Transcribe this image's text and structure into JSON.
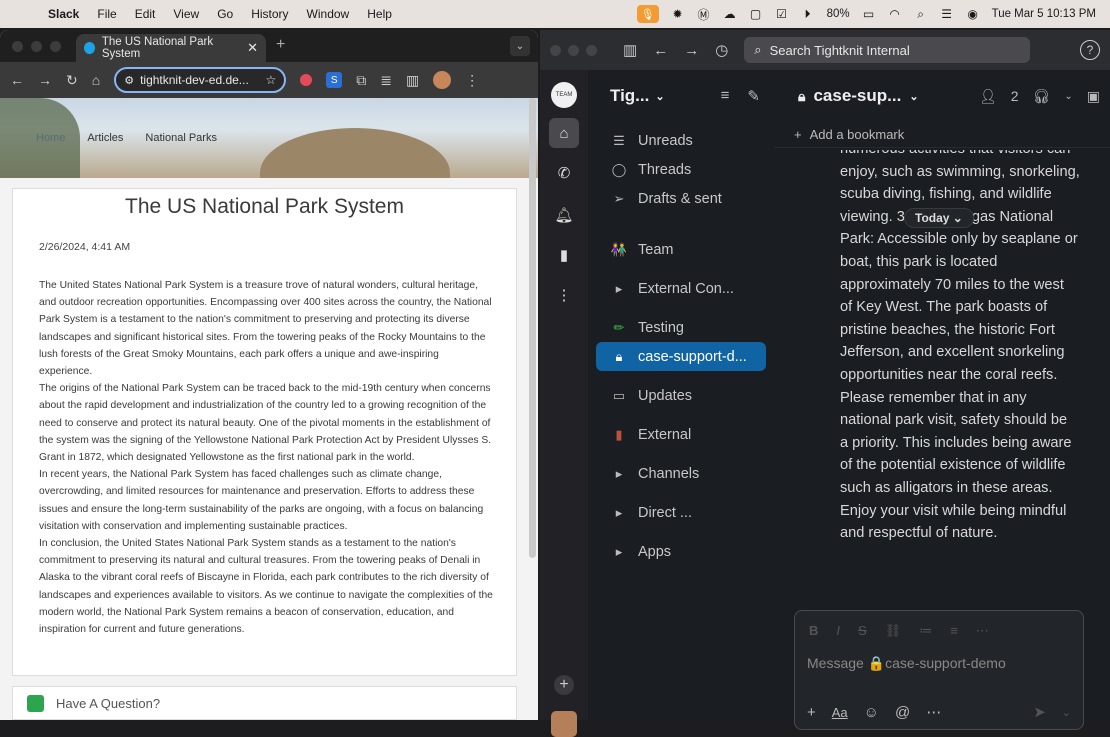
{
  "menubar": {
    "apple": "",
    "app": "Slack",
    "items": [
      "File",
      "Edit",
      "View",
      "Go",
      "History",
      "Window",
      "Help"
    ],
    "battery": "80%",
    "datetime": "Tue Mar 5  10:13 PM"
  },
  "browser": {
    "tab_title": "The US National Park System",
    "url": "tightknit-dev-ed.de...",
    "breadcrumbs": [
      "Home",
      "Articles",
      "National Parks"
    ],
    "article": {
      "title": "The US National Park System",
      "date": "2/26/2024, 4:41 AM",
      "paragraphs": [
        "The United States National Park System is a treasure trove of natural wonders, cultural heritage, and outdoor recreation opportunities. Encompassing over 400 sites across the country, the National Park System is a testament to the nation's commitment to preserving and protecting its diverse landscapes and significant historical sites. From the towering peaks of the Rocky Mountains to the lush forests of the Great Smoky Mountains, each park offers a unique and awe-inspiring experience.",
        "The origins of the National Park System can be traced back to the mid-19th century when concerns about the rapid development and industrialization of the country led to a growing recognition of the need to conserve and protect its natural beauty. One of the pivotal moments in the establishment of the system was the signing of the Yellowstone National Park Protection Act by President Ulysses S. Grant in 1872, which designated Yellowstone as the first national park in the world.",
        "In recent years, the National Park System has faced challenges such as climate change, overcrowding, and limited resources for maintenance and preservation. Efforts to address these issues and ensure the long-term sustainability of the parks are ongoing, with a focus on balancing visitation with conservation and implementing sustainable practices.",
        "In conclusion, the United States National Park System stands as a testament to the nation's commitment to preserving its natural and cultural treasures. From the towering peaks of Denali in Alaska to the vibrant coral reefs of Biscayne in Florida, each park contributes to the rich diversity of landscapes and experiences available to visitors. As we continue to navigate the complexities of the modern world, the National Park System remains a beacon of conservation, education, and inspiration for current and future generations."
      ]
    },
    "question_label": "Have A Question?"
  },
  "slack": {
    "search_placeholder": "Search Tightknit Internal",
    "workspace": "Tig...",
    "sidebar": [
      {
        "icon": "unreads-icon",
        "glyph": "☰",
        "label": "Unreads"
      },
      {
        "icon": "threads-icon",
        "glyph": "◯",
        "label": "Threads"
      },
      {
        "icon": "drafts-icon",
        "glyph": "➢",
        "label": "Drafts & sent"
      },
      {
        "icon": "team-icon",
        "glyph": "👫",
        "label": "Team"
      },
      {
        "icon": "caret-right-icon",
        "glyph": "▸",
        "label": "External Con..."
      },
      {
        "icon": "pencil-icon",
        "glyph": "✏",
        "label": "Testing"
      },
      {
        "icon": "lock-icon",
        "glyph": "🔒",
        "label": "case-support-d..."
      },
      {
        "icon": "updates-icon",
        "glyph": "▭",
        "label": "Updates"
      },
      {
        "icon": "external-icon",
        "glyph": "▮",
        "label": "External"
      },
      {
        "icon": "caret-right-icon",
        "glyph": "▸",
        "label": "Channels"
      },
      {
        "icon": "caret-right-icon",
        "glyph": "▸",
        "label": "Direct ..."
      },
      {
        "icon": "caret-right-icon",
        "glyph": "▸",
        "label": "Apps"
      }
    ],
    "channel": "case-sup...",
    "member_count": "2",
    "bookmark_label": "Add a bookmark",
    "today_label": "Today",
    "message_lines": [
      "numerous activities that visitors can",
      "enjoy, such as swimming, snorkeling,",
      "scuba diving, fishing, and wildlife",
      "viewing. 3. Dry Tortugas National",
      "Park: Accessible only by seaplane or",
      "boat, this park is located",
      "approximately 70 miles to the west",
      "of Key West. The park boasts of",
      "pristine beaches, the historic Fort",
      "Jefferson, and excellent snorkeling",
      "opportunities near the coral reefs.",
      "Please remember that in any",
      "national park visit, safety should be",
      "a priority. This includes being aware",
      "of the potential existence of wildlife",
      "such as alligators in these areas.",
      "Enjoy your visit while being mindful",
      "and respectful of nature."
    ],
    "composer_placeholder": "Message 🔒case-support-demo"
  }
}
